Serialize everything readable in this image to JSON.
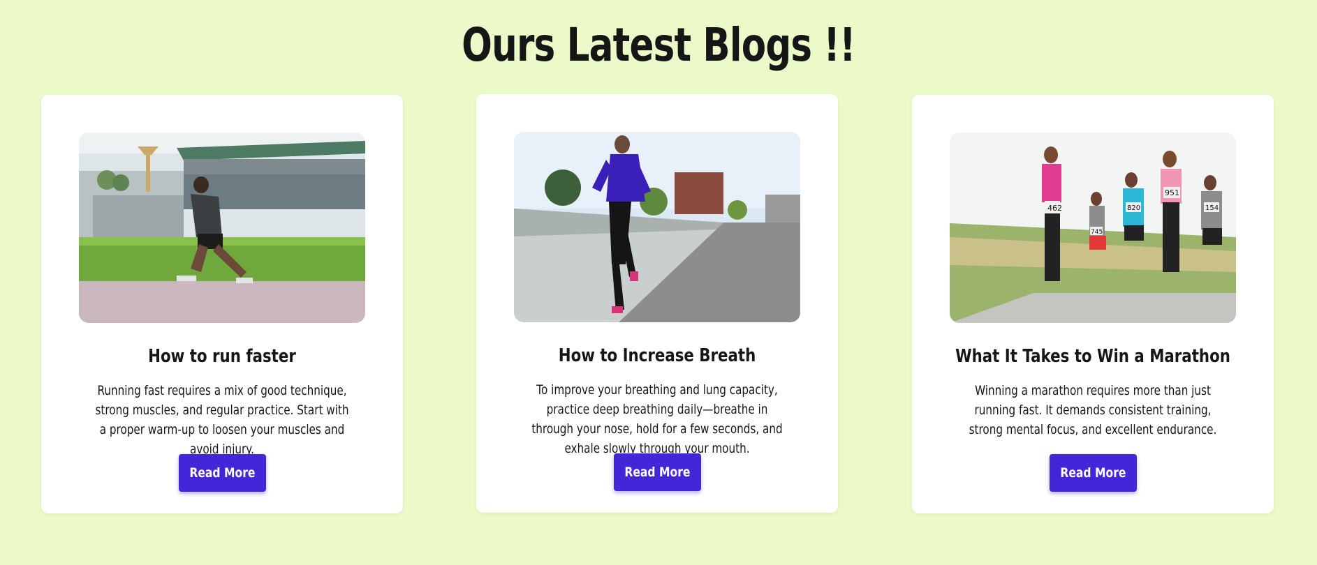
{
  "page": {
    "title": "Ours Latest Blogs !!"
  },
  "colors": {
    "background": "#ebfac8",
    "button": "#4326d8",
    "card": "#ffffff",
    "text": "#161616"
  },
  "cards": [
    {
      "title": "How to run faster",
      "text": "Running fast requires a mix of good technique, strong muscles, and regular practice. Start with a proper warm-up to loosen your muscles and avoid injury.",
      "button": "Read More"
    },
    {
      "title": "How to Increase Breath",
      "text": "To improve your breathing and lung capacity, practice deep breathing daily—breathe in through your nose, hold for a few seconds, and exhale slowly through your mouth.",
      "button": "Read More"
    },
    {
      "title": "What It Takes to Win a Marathon",
      "text": "Winning a marathon requires more than just running fast. It demands consistent training, strong mental focus, and excellent endurance.",
      "button": "Read More"
    }
  ]
}
